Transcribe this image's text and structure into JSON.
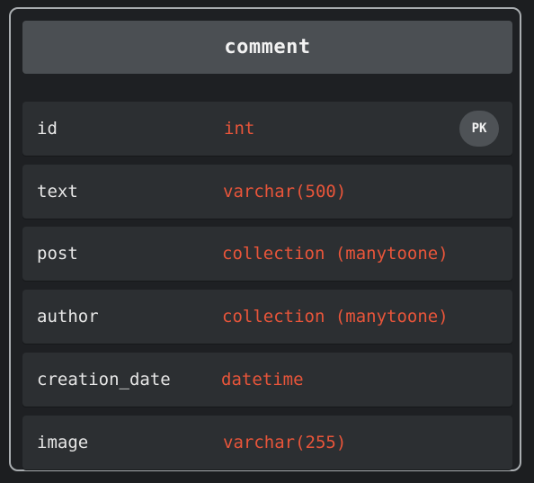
{
  "entity": {
    "title": "comment",
    "fields": [
      {
        "name": "id",
        "type": "int",
        "badge": "PK"
      },
      {
        "name": "text",
        "type": "varchar(500)"
      },
      {
        "name": "post",
        "type": "collection (manytoone)"
      },
      {
        "name": "author",
        "type": "collection (manytoone)"
      },
      {
        "name": "creation_date",
        "type": "datetime"
      },
      {
        "name": "image",
        "type": "varchar(255)"
      }
    ]
  },
  "colors": {
    "type_text": "#e8553a",
    "header_bg": "#4b4f53",
    "row_bg": "#2c2f32",
    "border": "#a9adb0"
  }
}
